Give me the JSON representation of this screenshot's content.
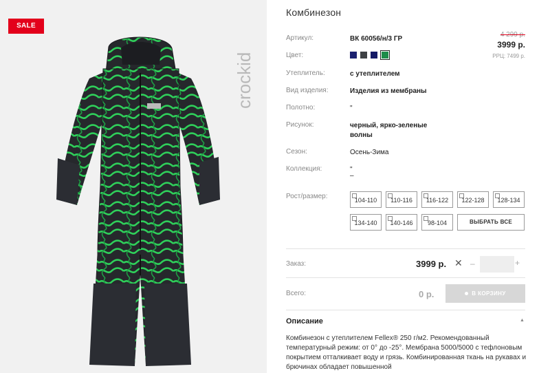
{
  "badge": "SALE",
  "brand": "crockid",
  "product": {
    "title": "Комбинезон",
    "price_old": "4 299 р.",
    "price": "3999 р.",
    "rrp": "РРЦ: 7499 р."
  },
  "specs": {
    "article": {
      "label": "Артикул:",
      "value": "ВК 60056/н/3 ГР"
    },
    "color": {
      "label": "Цвет:",
      "swatches": [
        "#1b2170",
        "#3e4144",
        "#141a66",
        "#1e8c4a"
      ],
      "selected_index": 3
    },
    "insulation": {
      "label": "Утеплитель:",
      "value": "с утеплителем"
    },
    "type": {
      "label": "Вид изделия:",
      "value": "Изделия из мембраны"
    },
    "fabric": {
      "label": "Полотно:",
      "value": "\""
    },
    "pattern": {
      "label": "Рисунок:",
      "line1": "черный, ярко-зеленые",
      "line2": "волны"
    },
    "season": {
      "label": "Сезон:",
      "value": "Осень-Зима"
    },
    "collection": {
      "label": "Коллекция:",
      "line1": "\"",
      "line2": "–"
    }
  },
  "sizes": {
    "label": "Рост/размер:",
    "options": [
      "104-110",
      "110-116",
      "116-122",
      "122-128",
      "128-134",
      "134-140",
      "140-146",
      "98-104"
    ],
    "select_all": "ВЫБРАТЬ ВСЕ"
  },
  "order": {
    "label": "Заказ:",
    "price": "3999 р.",
    "remove": "✕",
    "minus": "–",
    "plus": "+",
    "quantity": ""
  },
  "total": {
    "label": "Всего:",
    "price": "0 р.",
    "cart_button": "В КОРЗИНУ"
  },
  "description": {
    "title": "Описание",
    "text": "Комбинезон с утеплителем Fellex® 250 г/м2. Рекомендованный температурный режим: от 0° до -25°. Мембрана 5000/5000 с тефлоновым покрытием отталкивает воду и грязь. Комбинированная ткань на рукавах и брючинах обладает повышенной"
  },
  "colors": {
    "sale": "#e3001b",
    "pattern_green": "#2fd05a",
    "garment_dark": "#2b2d33"
  }
}
